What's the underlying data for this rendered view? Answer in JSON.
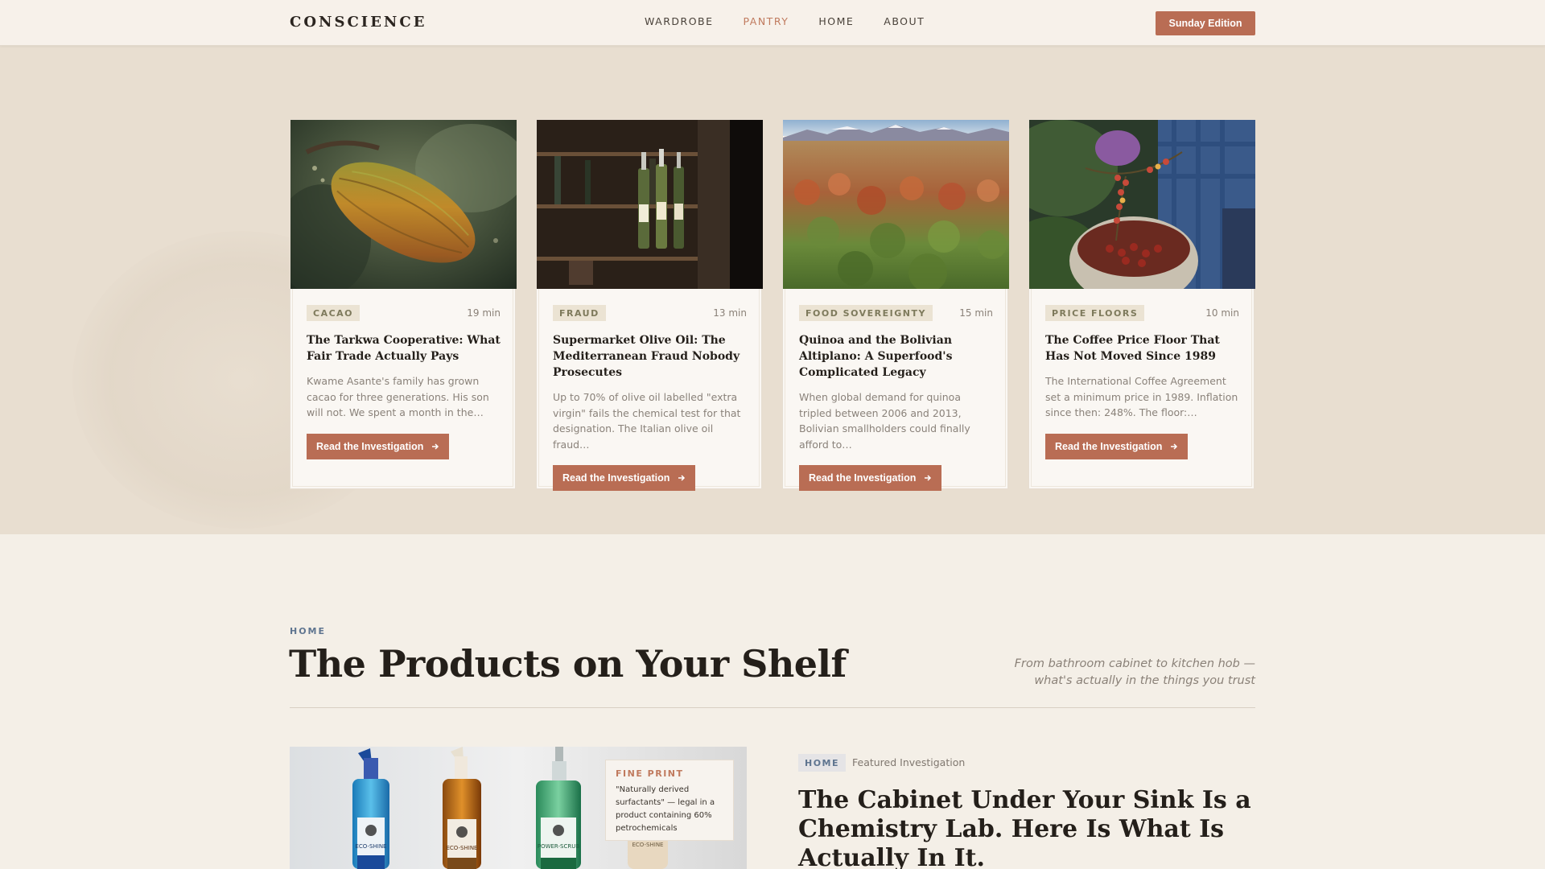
{
  "header": {
    "brand": "CONSCIENCE",
    "nav": [
      "WARDROBE",
      "PANTRY",
      "HOME",
      "ABOUT"
    ],
    "active_nav": "PANTRY",
    "edition_button": "Sunday Edition"
  },
  "pantry": {
    "cards": [
      {
        "tag": "CACAO",
        "read_time": "19 min",
        "title": "The Tarkwa Cooperative: What Fair Trade Actually Pays",
        "excerpt": "Kwame Asante's family has grown cacao for three generations. His son will not. We spent a month in the…",
        "button": "Read the Investigation",
        "image": "cacao-pod-photo"
      },
      {
        "tag": "FRAUD",
        "read_time": "13 min",
        "title": "Supermarket Olive Oil: The Mediterranean Fraud Nobody Prosecutes",
        "excerpt": "Up to 70% of olive oil labelled \"extra virgin\" fails the chemical test for that designation. The Italian olive oil fraud…",
        "button": "Read the Investigation",
        "image": "olive-oil-bottles-photo"
      },
      {
        "tag": "FOOD SOVEREIGNTY",
        "read_time": "15 min",
        "title": "Quinoa and the Bolivian Altiplano: A Superfood's Complicated Legacy",
        "excerpt": "When global demand for quinoa tripled between 2006 and 2013, Bolivian smallholders could finally afford to…",
        "button": "Read the Investigation",
        "image": "quinoa-field-photo"
      },
      {
        "tag": "PRICE FLOORS",
        "read_time": "10 min",
        "title": "The Coffee Price Floor That Has Not Moved Since 1989",
        "excerpt": "The International Coffee Agreement set a minimum price in 1989. Inflation since then: 248%. The floor:…",
        "button": "Read the Investigation",
        "image": "coffee-cherries-photo"
      }
    ]
  },
  "home_section": {
    "eyebrow": "HOME",
    "title": "The Products on Your Shelf",
    "subtitle": "From bathroom cabinet to kitchen hob — what's actually in the things you trust",
    "feature": {
      "tag": "HOME",
      "label": "Featured Investigation",
      "title": "The Cabinet Under Your Sink Is a Chemistry Lab. Here Is What Is Actually In It.",
      "fine_print_label": "FINE PRINT",
      "fine_print_quote": "\"Naturally derived surfactants\" — legal in a product containing 60% petrochemicals",
      "bottle_labels": [
        "ECO-SHINE",
        "ECO-SHINE",
        "POWER-SCRUB",
        "ECO-SHINE"
      ]
    }
  },
  "colors": {
    "accent": "#b96d54",
    "band_background": "#e8ded0",
    "page_background": "#f4efe7",
    "home_tag": "#5f7590"
  }
}
